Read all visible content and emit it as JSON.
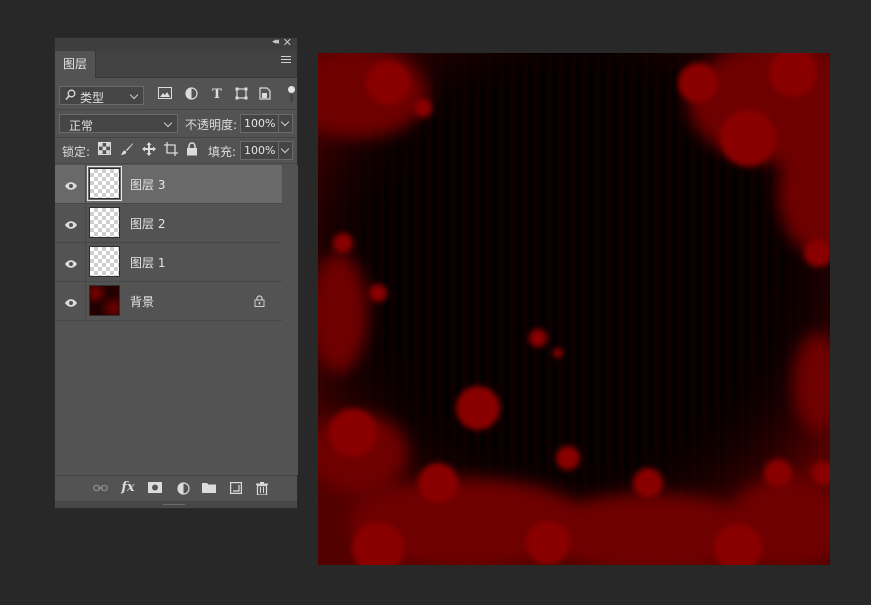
{
  "panel": {
    "collapse_glyph": "◂◂",
    "close_glyph": "✕",
    "tab_label": "图层",
    "menu_icon": "hamburger-icon"
  },
  "filter": {
    "kind_label": "类型",
    "search_icon": "search-icon",
    "icons": [
      "image-filter-icon",
      "adjustment-filter-icon",
      "type-filter-icon",
      "shape-filter-icon",
      "smart-object-filter-icon"
    ]
  },
  "blend": {
    "mode": "正常",
    "opacity_label": "不透明度:",
    "opacity_value": "100%"
  },
  "lock": {
    "label": "锁定:",
    "fill_label": "填充:",
    "fill_value": "100%"
  },
  "layers": [
    {
      "name": "图层 3",
      "selected": true,
      "visible": true,
      "locked": false
    },
    {
      "name": "图层 2",
      "selected": false,
      "visible": true,
      "locked": false
    },
    {
      "name": "图层 1",
      "selected": false,
      "visible": true,
      "locked": false
    },
    {
      "name": "背景",
      "selected": false,
      "visible": true,
      "locked": true
    }
  ],
  "bottom_toolbar": {
    "fx_label": "fx"
  },
  "colors": {
    "workspace": "#282828",
    "panel": "#535353",
    "selected_layer": "#696969",
    "canvas_base": "#040000",
    "blood": "#7a0000"
  }
}
